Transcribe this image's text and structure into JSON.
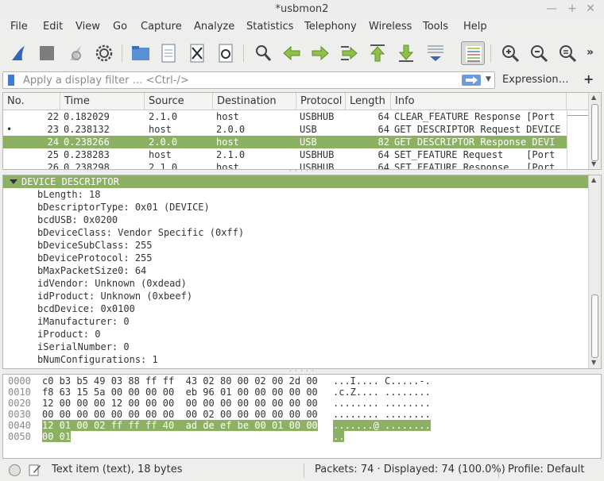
{
  "window": {
    "title": "*usbmon2"
  },
  "menu": [
    "File",
    "Edit",
    "View",
    "Go",
    "Capture",
    "Analyze",
    "Statistics",
    "Telephony",
    "Wireless",
    "Tools",
    "Help"
  ],
  "toolbar": {
    "buttons": [
      "shark-fin-start-icon",
      "stop-square-icon",
      "restart-capture-icon",
      "capture-options-gear-icon",
      "open-folder-icon",
      "save-file-icon",
      "close-file-icon",
      "reload-file-icon",
      "find-packet-icon",
      "go-back-icon",
      "go-forward-icon",
      "go-to-packet-icon",
      "go-first-icon",
      "go-last-icon",
      "autoscroll-icon",
      "colorize-icon",
      "zoom-in-icon",
      "zoom-out-icon",
      "normal-size-icon"
    ],
    "overflow": "»"
  },
  "filter": {
    "placeholder": "Apply a display filter … <Ctrl-/>",
    "expression_label": "Expression…",
    "add_label": "+"
  },
  "packet_list": {
    "columns": [
      "No.",
      "Time",
      "Source",
      "Destination",
      "Protocol",
      "Length",
      "Info"
    ],
    "rows": [
      {
        "no": "22",
        "time": "0.182029",
        "source": "2.1.0",
        "destination": "host",
        "protocol": "USBHUB",
        "length": "64",
        "info": "CLEAR_FEATURE Response [Port",
        "marker": "",
        "selected": false
      },
      {
        "no": "23",
        "time": "0.238132",
        "source": "host",
        "destination": "2.0.0",
        "protocol": "USB",
        "length": "64",
        "info": "GET DESCRIPTOR Request DEVICE",
        "marker": "•",
        "selected": false
      },
      {
        "no": "24",
        "time": "0.238266",
        "source": "2.0.0",
        "destination": "host",
        "protocol": "USB",
        "length": "82",
        "info": "GET DESCRIPTOR Response DEVI",
        "marker": "",
        "selected": true
      },
      {
        "no": "25",
        "time": "0.238283",
        "source": "host",
        "destination": "2.1.0",
        "protocol": "USBHUB",
        "length": "64",
        "info": "SET_FEATURE Request    [Port",
        "marker": "",
        "selected": false
      },
      {
        "no": "26",
        "time": "0.238298",
        "source": "2.1.0",
        "destination": "host",
        "protocol": "USBHUB",
        "length": "64",
        "info": "SET_FEATURE Response   [Port",
        "marker": "",
        "selected": false
      }
    ]
  },
  "details": {
    "header": "DEVICE DESCRIPTOR",
    "lines": [
      "bLength: 18",
      "bDescriptorType: 0x01 (DEVICE)",
      "bcdUSB: 0x0200",
      "bDeviceClass: Vendor Specific (0xff)",
      "bDeviceSubClass: 255",
      "bDeviceProtocol: 255",
      "bMaxPacketSize0: 64",
      "idVendor: Unknown (0xdead)",
      "idProduct: Unknown (0xbeef)",
      "bcdDevice: 0x0100",
      "iManufacturer: 0",
      "iProduct: 0",
      "iSerialNumber: 0",
      "bNumConfigurations: 1"
    ]
  },
  "bytes": [
    {
      "offset": "0000",
      "hex": "c0 b3 b5 49 03 88 ff ff  43 02 80 00 02 00 2d 00",
      "hex_hl": "",
      "ascii": "...I.... C.....-.",
      "ascii_hl": ""
    },
    {
      "offset": "0010",
      "hex": "f8 63 15 5a 00 00 00 00  eb 96 01 00 00 00 00 00",
      "hex_hl": "",
      "ascii": ".c.Z.... ........",
      "ascii_hl": ""
    },
    {
      "offset": "0020",
      "hex": "12 00 00 00 12 00 00 00  00 00 00 00 00 00 00 00",
      "hex_hl": "",
      "ascii": "........ ........",
      "ascii_hl": ""
    },
    {
      "offset": "0030",
      "hex": "00 00 00 00 00 00 00 00  00 02 00 00 00 00 00 00",
      "hex_hl": "",
      "ascii": "........ ........",
      "ascii_hl": ""
    },
    {
      "offset": "0040",
      "hex": "",
      "hex_hl": "12 01 00 02 ff ff ff 40  ad de ef be 00 01 00 00",
      "ascii": "",
      "ascii_hl": ".......@ ........"
    },
    {
      "offset": "0050",
      "hex": "",
      "hex_hl": "00 01",
      "ascii": "",
      "ascii_hl": ".."
    }
  ],
  "status": {
    "item": "Text item (text), 18 bytes",
    "packets": "Packets: 74 · Displayed: 74 (100.0%)",
    "profile": "Profile: Default"
  },
  "colors": {
    "selection": "#8cb163",
    "background": "#eeeeec"
  }
}
